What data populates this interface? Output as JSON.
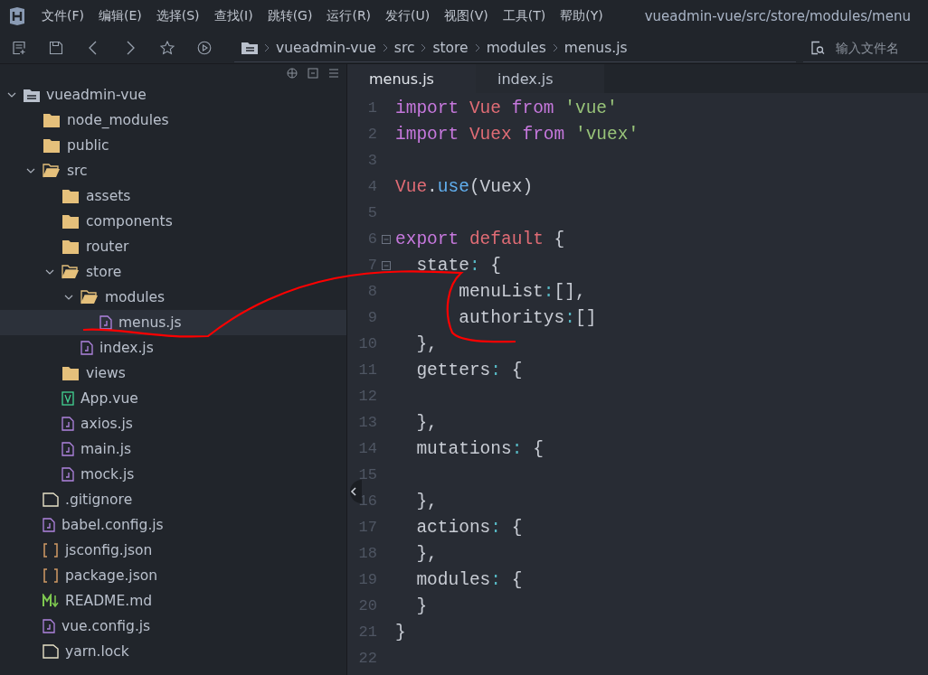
{
  "menu_bar": {
    "items": [
      "文件(F)",
      "编辑(E)",
      "选择(S)",
      "查找(I)",
      "跳转(G)",
      "运行(R)",
      "发行(U)",
      "视图(V)",
      "工具(T)",
      "帮助(Y)"
    ],
    "title": "vueadmin-vue/src/store/modules/menu"
  },
  "toolbar": {
    "breadcrumb": [
      "vueadmin-vue",
      "src",
      "store",
      "modules",
      "menus.js"
    ],
    "search": {
      "placeholder": "输入文件名"
    }
  },
  "tree": [
    {
      "label": "vueadmin-vue",
      "kind": "project",
      "expanded": true,
      "selected": false,
      "children": [
        {
          "label": "node_modules",
          "kind": "folder",
          "expanded": false,
          "selected": false
        },
        {
          "label": "public",
          "kind": "folder",
          "expanded": false,
          "selected": false
        },
        {
          "label": "src",
          "kind": "folder",
          "expanded": true,
          "selected": false,
          "children": [
            {
              "label": "assets",
              "kind": "folder",
              "expanded": false,
              "selected": false
            },
            {
              "label": "components",
              "kind": "folder",
              "expanded": false,
              "selected": false
            },
            {
              "label": "router",
              "kind": "folder",
              "expanded": false,
              "selected": false
            },
            {
              "label": "store",
              "kind": "folder",
              "expanded": true,
              "selected": false,
              "children": [
                {
                  "label": "modules",
                  "kind": "folder",
                  "expanded": true,
                  "selected": false,
                  "children": [
                    {
                      "label": "menus.js",
                      "kind": "js",
                      "selected": true
                    }
                  ]
                },
                {
                  "label": "index.js",
                  "kind": "js",
                  "selected": false
                }
              ]
            },
            {
              "label": "views",
              "kind": "folder",
              "expanded": false,
              "selected": false
            },
            {
              "label": "App.vue",
              "kind": "vue",
              "selected": false
            },
            {
              "label": "axios.js",
              "kind": "js",
              "selected": false
            },
            {
              "label": "main.js",
              "kind": "js",
              "selected": false
            },
            {
              "label": "mock.js",
              "kind": "js",
              "selected": false
            }
          ]
        },
        {
          "label": ".gitignore",
          "kind": "text",
          "selected": false
        },
        {
          "label": "babel.config.js",
          "kind": "js",
          "selected": false
        },
        {
          "label": "jsconfig.json",
          "kind": "json",
          "selected": false
        },
        {
          "label": "package.json",
          "kind": "json",
          "selected": false
        },
        {
          "label": "README.md",
          "kind": "markdown",
          "selected": false
        },
        {
          "label": "vue.config.js",
          "kind": "js",
          "selected": false
        },
        {
          "label": "yarn.lock",
          "kind": "text",
          "selected": false
        }
      ]
    }
  ],
  "tabs": [
    {
      "label": "menus.js",
      "selected": true
    },
    {
      "label": "index.js",
      "selected": false
    }
  ],
  "editor": {
    "lines": [
      {
        "number": "1",
        "fold": false,
        "tokens": [
          {
            "kind": "keyword",
            "text": "import"
          },
          {
            "kind": "name",
            "text": " Vue"
          },
          {
            "kind": "keyword",
            "text": " from"
          },
          {
            "kind": "string",
            "text": " 'vue'"
          }
        ]
      },
      {
        "number": "2",
        "fold": false,
        "tokens": [
          {
            "kind": "keyword",
            "text": "import"
          },
          {
            "kind": "name",
            "text": " Vuex"
          },
          {
            "kind": "keyword",
            "text": " from"
          },
          {
            "kind": "string",
            "text": " 'vuex'"
          }
        ]
      },
      {
        "number": "3",
        "fold": false
      },
      {
        "number": "4",
        "fold": false,
        "tokens": [
          {
            "kind": "name",
            "text": "Vue"
          },
          {
            "kind": "plain",
            "text": "."
          },
          {
            "kind": "method",
            "text": "use"
          },
          {
            "kind": "plain",
            "text": "(Vuex)"
          }
        ]
      },
      {
        "number": "5",
        "fold": false
      },
      {
        "number": "6",
        "fold": true,
        "tokens": [
          {
            "kind": "keyword",
            "text": "export"
          },
          {
            "kind": "name",
            "text": " default"
          },
          {
            "kind": "plain",
            "text": " {"
          }
        ]
      },
      {
        "number": "7",
        "fold": true,
        "tokens": [
          {
            "kind": "plain",
            "text": "  state"
          },
          {
            "kind": "punct",
            "text": ":"
          },
          {
            "kind": "plain",
            "text": " {"
          }
        ]
      },
      {
        "number": "8",
        "fold": false,
        "tokens": [
          {
            "kind": "plain",
            "text": "      menuList"
          },
          {
            "kind": "punct",
            "text": ":"
          },
          {
            "kind": "plain",
            "text": "[],"
          }
        ]
      },
      {
        "number": "9",
        "fold": false,
        "tokens": [
          {
            "kind": "plain",
            "text": "      authoritys"
          },
          {
            "kind": "punct",
            "text": ":"
          },
          {
            "kind": "plain",
            "text": "[]"
          }
        ]
      },
      {
        "number": "10",
        "fold": false,
        "tokens": [
          {
            "kind": "plain",
            "text": "  },"
          }
        ]
      },
      {
        "number": "11",
        "fold": false,
        "tokens": [
          {
            "kind": "plain",
            "text": "  getters"
          },
          {
            "kind": "punct",
            "text": ":"
          },
          {
            "kind": "plain",
            "text": " {"
          }
        ]
      },
      {
        "number": "12",
        "fold": false
      },
      {
        "number": "13",
        "fold": false,
        "tokens": [
          {
            "kind": "plain",
            "text": "  },"
          }
        ]
      },
      {
        "number": "14",
        "fold": false,
        "tokens": [
          {
            "kind": "plain",
            "text": "  mutations"
          },
          {
            "kind": "punct",
            "text": ":"
          },
          {
            "kind": "plain",
            "text": " {"
          }
        ]
      },
      {
        "number": "15",
        "fold": false
      },
      {
        "number": "16",
        "fold": false,
        "tokens": [
          {
            "kind": "plain",
            "text": "  },"
          }
        ]
      },
      {
        "number": "17",
        "fold": false,
        "tokens": [
          {
            "kind": "plain",
            "text": "  actions"
          },
          {
            "kind": "punct",
            "text": ":"
          },
          {
            "kind": "plain",
            "text": " {"
          }
        ]
      },
      {
        "number": "18",
        "fold": false,
        "tokens": [
          {
            "kind": "plain",
            "text": "  },"
          }
        ]
      },
      {
        "number": "19",
        "fold": false,
        "tokens": [
          {
            "kind": "plain",
            "text": "  modules"
          },
          {
            "kind": "punct",
            "text": ":"
          },
          {
            "kind": "plain",
            "text": " {"
          }
        ]
      },
      {
        "number": "20",
        "fold": false,
        "tokens": [
          {
            "kind": "plain",
            "text": "  }"
          }
        ]
      },
      {
        "number": "21",
        "fold": false,
        "tokens": [
          {
            "kind": "plain",
            "text": "}"
          }
        ]
      },
      {
        "number": "22",
        "fold": false
      }
    ]
  },
  "red_markup": true
}
